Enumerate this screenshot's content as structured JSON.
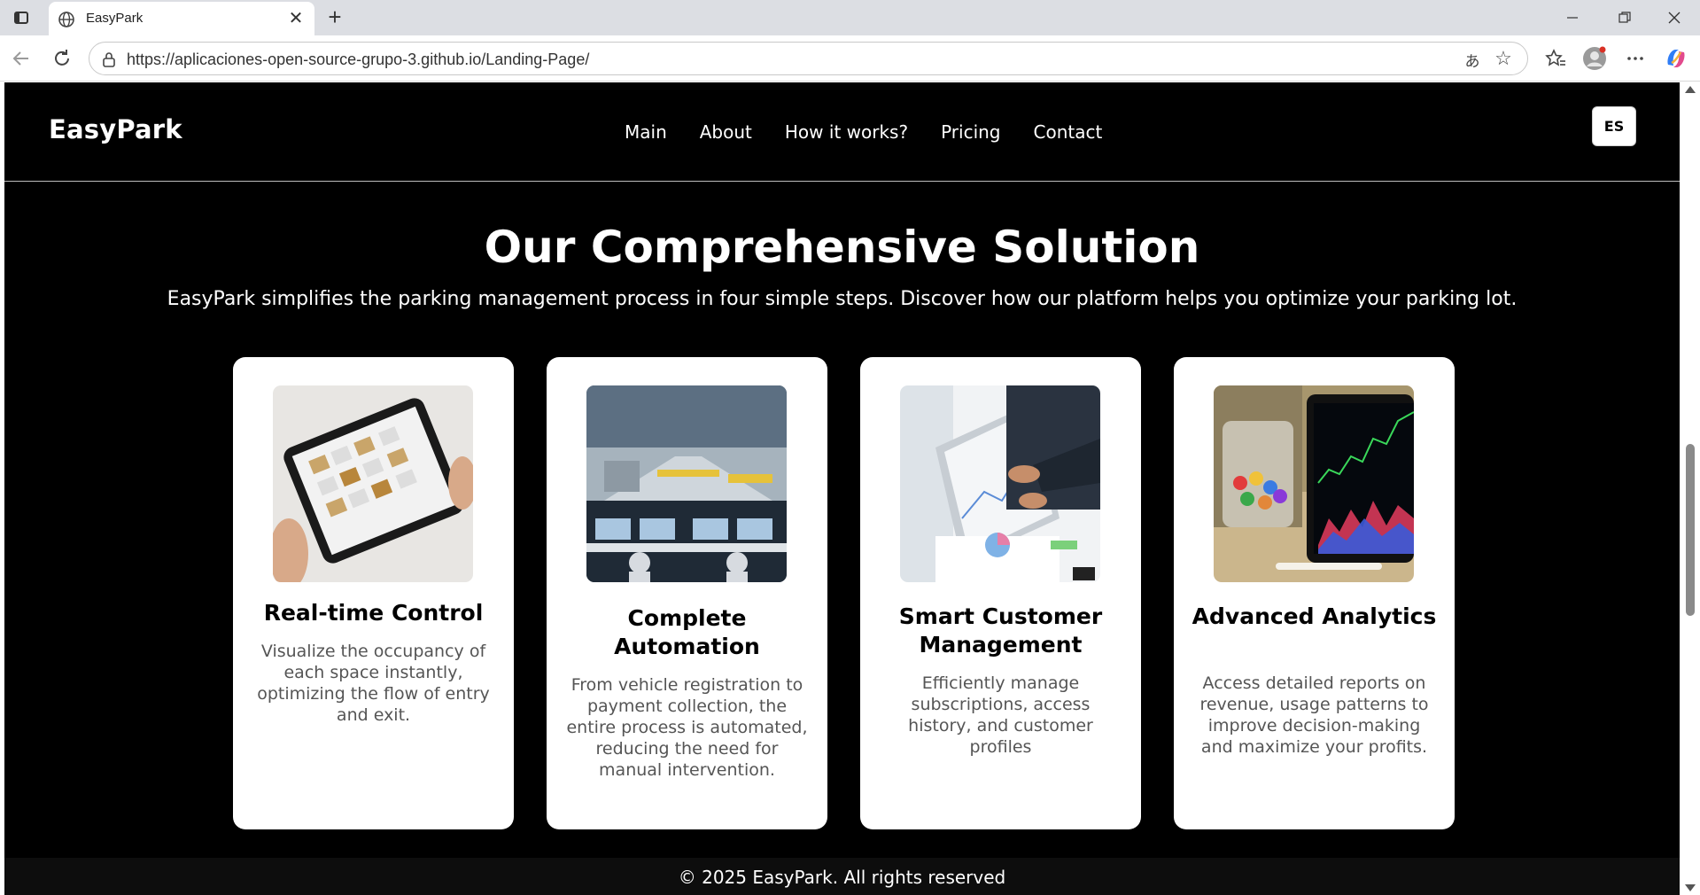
{
  "browser": {
    "tab_title": "EasyPark",
    "url": "https://aplicaciones-open-source-grupo-3.github.io/Landing-Page/",
    "icons": {
      "tab_actions": "tab-actions-icon",
      "favicon": "globe-icon",
      "tab_close": "close-icon",
      "new_tab": "plus-icon",
      "back": "back-arrow-icon",
      "refresh": "refresh-icon",
      "site_info": "site-info-icon",
      "read_aloud": "read-aloud-icon",
      "favorite": "star-icon",
      "favorites": "favorites-icon",
      "profile": "profile-icon",
      "more": "more-icon",
      "copilot": "copilot-icon"
    }
  },
  "site": {
    "brand": "EasyPark",
    "nav": [
      "Main",
      "About",
      "How it works?",
      "Pricing",
      "Contact"
    ],
    "lang_button": "ES",
    "section": {
      "title": "Our Comprehensive Solution",
      "subtitle": "EasyPark simplifies the parking management process in four simple steps. Discover how our platform helps you optimize your parking lot."
    },
    "cards": [
      {
        "title": "Real-time Control",
        "text": "Visualize the occupancy of each space instantly, optimizing the flow of entry and exit."
      },
      {
        "title": "Complete Automation",
        "text": "From vehicle registration to payment collection, the entire process is automated, reducing the need for manual intervention."
      },
      {
        "title": "Smart Customer Management",
        "text": "Efficiently manage subscriptions, access history, and customer profiles"
      },
      {
        "title": "Advanced Analytics",
        "text": "Access detailed reports on revenue, usage patterns to improve decision-making and maximize your profits."
      }
    ],
    "footer": "© 2025 EasyPark. All rights reserved"
  },
  "colors": {
    "page_bg": "#000000",
    "card_bg": "#ffffff",
    "card_text": "#555555",
    "chrome_tabbar": "#dcdee3"
  }
}
